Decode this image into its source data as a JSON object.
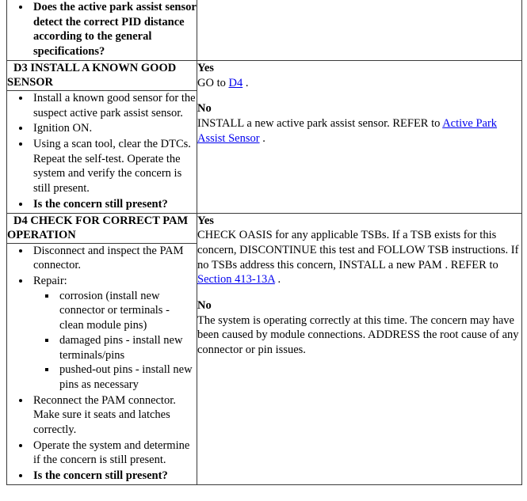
{
  "document": {
    "kind": "pinpoint-test-table",
    "link_color": "#0000ee",
    "text_color": "#000000",
    "border_color": "#3a3a3a"
  },
  "rows": {
    "top_partial": {
      "actions": [
        {
          "text": "Does the active park assist sensor detect the correct PID distance according to the general specifications?",
          "bold": true
        }
      ],
      "results": []
    },
    "d3": {
      "header": "D3 INSTALL A KNOWN GOOD SENSOR",
      "actions": [
        {
          "text": "Install a known good sensor for the suspect active park assist sensor.",
          "bold": false
        },
        {
          "text": "Ignition ON.",
          "bold": false
        },
        {
          "text": "Using a scan tool, clear the DTCs. Repeat the self-test. Operate the system and verify the concern is still present.",
          "bold": false
        },
        {
          "text": "Is the concern still present?",
          "bold": true
        }
      ],
      "results": [
        {
          "label": "Yes",
          "pre": "GO to ",
          "link": "D4",
          "post": " ."
        },
        {
          "label": "No",
          "pre": "INSTALL a new active park assist sensor. REFER to ",
          "link": "Active Park Assist Sensor",
          "post": " ."
        }
      ]
    },
    "d4": {
      "header": "D4 CHECK FOR CORRECT PAM OPERATION",
      "actions": [
        {
          "text": "Disconnect and inspect the PAM connector.",
          "bold": false
        },
        {
          "text": "Repair:",
          "bold": false,
          "sub": [
            "corrosion (install new connector or terminals - clean module pins)",
            "damaged pins - install new terminals/pins",
            "pushed-out pins - install new pins as necessary"
          ]
        },
        {
          "text": "Reconnect the PAM connector. Make sure it seats and latches correctly.",
          "bold": false
        },
        {
          "text": "Operate the system and determine if the concern is still present.",
          "bold": false
        },
        {
          "text": "Is the concern still present?",
          "bold": true
        }
      ],
      "results": [
        {
          "label": "Yes",
          "pre": "CHECK OASIS for any applicable TSBs. If a TSB exists for this concern, DISCONTINUE this test and FOLLOW TSB instructions. If no TSBs address this concern, INSTALL a new PAM . REFER to ",
          "link": "Section 413-13A",
          "post": " ."
        },
        {
          "label": "No",
          "pre": "The system is operating correctly at this time. The concern may have been caused by module connections. ADDRESS the root cause of any connector or pin issues.",
          "link": "",
          "post": ""
        }
      ]
    }
  }
}
